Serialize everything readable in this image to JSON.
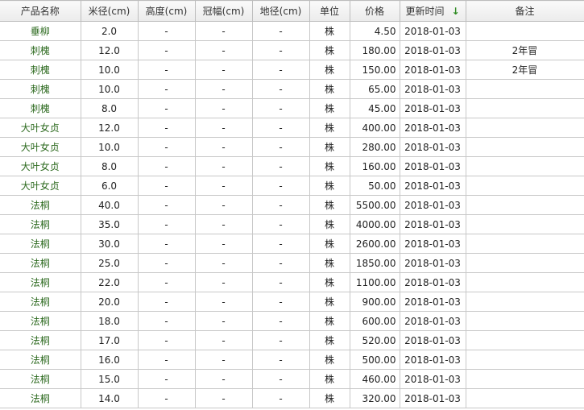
{
  "headers": {
    "name": "产品名称",
    "diameter": "米径(cm)",
    "height": "高度(cm)",
    "crown": "冠幅(cm)",
    "ground_diameter": "地径(cm)",
    "unit": "单位",
    "price": "价格",
    "updated": "更新时间",
    "note": "备注",
    "sort_icon": "↓"
  },
  "sort_color": "#2e8b22",
  "rows": [
    {
      "name": "垂柳",
      "diameter": "2.0",
      "height": "-",
      "crown": "-",
      "ground_diameter": "-",
      "unit": "株",
      "price": "4.50",
      "updated": "2018-01-03",
      "note": ""
    },
    {
      "name": "刺槐",
      "diameter": "12.0",
      "height": "-",
      "crown": "-",
      "ground_diameter": "-",
      "unit": "株",
      "price": "180.00",
      "updated": "2018-01-03",
      "note": "2年冒"
    },
    {
      "name": "刺槐",
      "diameter": "10.0",
      "height": "-",
      "crown": "-",
      "ground_diameter": "-",
      "unit": "株",
      "price": "150.00",
      "updated": "2018-01-03",
      "note": "2年冒"
    },
    {
      "name": "刺槐",
      "diameter": "10.0",
      "height": "-",
      "crown": "-",
      "ground_diameter": "-",
      "unit": "株",
      "price": "65.00",
      "updated": "2018-01-03",
      "note": ""
    },
    {
      "name": "刺槐",
      "diameter": "8.0",
      "height": "-",
      "crown": "-",
      "ground_diameter": "-",
      "unit": "株",
      "price": "45.00",
      "updated": "2018-01-03",
      "note": ""
    },
    {
      "name": "大叶女贞",
      "diameter": "12.0",
      "height": "-",
      "crown": "-",
      "ground_diameter": "-",
      "unit": "株",
      "price": "400.00",
      "updated": "2018-01-03",
      "note": ""
    },
    {
      "name": "大叶女贞",
      "diameter": "10.0",
      "height": "-",
      "crown": "-",
      "ground_diameter": "-",
      "unit": "株",
      "price": "280.00",
      "updated": "2018-01-03",
      "note": ""
    },
    {
      "name": "大叶女贞",
      "diameter": "8.0",
      "height": "-",
      "crown": "-",
      "ground_diameter": "-",
      "unit": "株",
      "price": "160.00",
      "updated": "2018-01-03",
      "note": ""
    },
    {
      "name": "大叶女贞",
      "diameter": "6.0",
      "height": "-",
      "crown": "-",
      "ground_diameter": "-",
      "unit": "株",
      "price": "50.00",
      "updated": "2018-01-03",
      "note": ""
    },
    {
      "name": "法桐",
      "diameter": "40.0",
      "height": "-",
      "crown": "-",
      "ground_diameter": "-",
      "unit": "株",
      "price": "5500.00",
      "updated": "2018-01-03",
      "note": ""
    },
    {
      "name": "法桐",
      "diameter": "35.0",
      "height": "-",
      "crown": "-",
      "ground_diameter": "-",
      "unit": "株",
      "price": "4000.00",
      "updated": "2018-01-03",
      "note": ""
    },
    {
      "name": "法桐",
      "diameter": "30.0",
      "height": "-",
      "crown": "-",
      "ground_diameter": "-",
      "unit": "株",
      "price": "2600.00",
      "updated": "2018-01-03",
      "note": ""
    },
    {
      "name": "法桐",
      "diameter": "25.0",
      "height": "-",
      "crown": "-",
      "ground_diameter": "-",
      "unit": "株",
      "price": "1850.00",
      "updated": "2018-01-03",
      "note": ""
    },
    {
      "name": "法桐",
      "diameter": "22.0",
      "height": "-",
      "crown": "-",
      "ground_diameter": "-",
      "unit": "株",
      "price": "1100.00",
      "updated": "2018-01-03",
      "note": ""
    },
    {
      "name": "法桐",
      "diameter": "20.0",
      "height": "-",
      "crown": "-",
      "ground_diameter": "-",
      "unit": "株",
      "price": "900.00",
      "updated": "2018-01-03",
      "note": ""
    },
    {
      "name": "法桐",
      "diameter": "18.0",
      "height": "-",
      "crown": "-",
      "ground_diameter": "-",
      "unit": "株",
      "price": "600.00",
      "updated": "2018-01-03",
      "note": ""
    },
    {
      "name": "法桐",
      "diameter": "17.0",
      "height": "-",
      "crown": "-",
      "ground_diameter": "-",
      "unit": "株",
      "price": "520.00",
      "updated": "2018-01-03",
      "note": ""
    },
    {
      "name": "法桐",
      "diameter": "16.0",
      "height": "-",
      "crown": "-",
      "ground_diameter": "-",
      "unit": "株",
      "price": "500.00",
      "updated": "2018-01-03",
      "note": ""
    },
    {
      "name": "法桐",
      "diameter": "15.0",
      "height": "-",
      "crown": "-",
      "ground_diameter": "-",
      "unit": "株",
      "price": "460.00",
      "updated": "2018-01-03",
      "note": ""
    },
    {
      "name": "法桐",
      "diameter": "14.0",
      "height": "-",
      "crown": "-",
      "ground_diameter": "-",
      "unit": "株",
      "price": "320.00",
      "updated": "2018-01-03",
      "note": ""
    }
  ]
}
